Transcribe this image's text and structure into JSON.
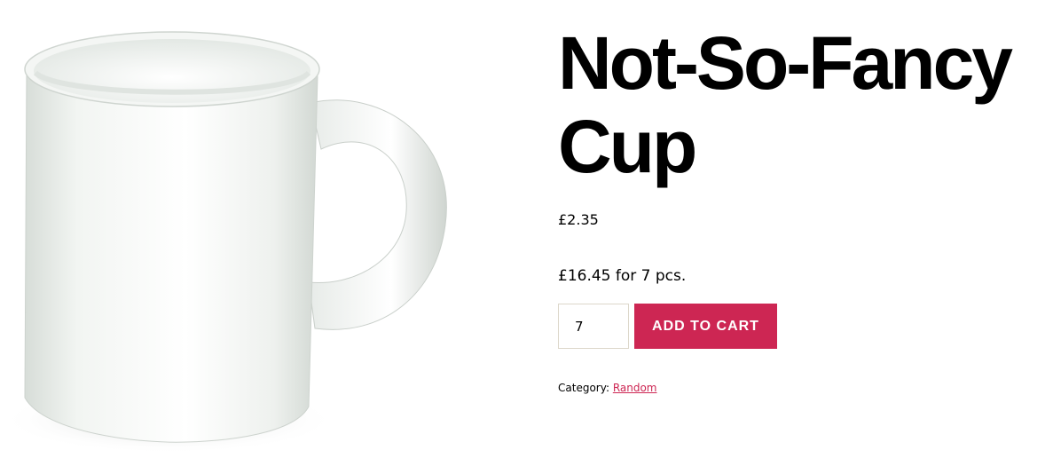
{
  "product": {
    "title": "Not-So-Fancy Cup",
    "price": "£2.35",
    "bulk_price": "£16.45 for 7 pcs.",
    "quantity": "7",
    "add_to_cart_label": "ADD TO CART",
    "category_label": "Category:",
    "category_link": "Random",
    "image_icon": "white-mug-image"
  },
  "colors": {
    "accent": "#cd2653",
    "text": "#000000",
    "background": "#ffffff"
  }
}
